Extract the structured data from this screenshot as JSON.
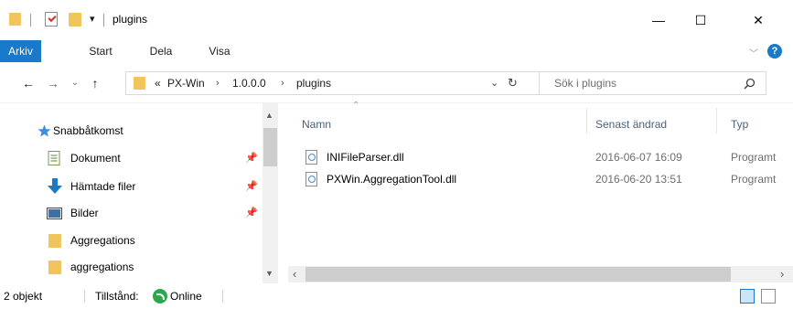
{
  "window": {
    "title": "plugins",
    "controls": {
      "minimize": "—",
      "maximize": "☐",
      "close": "✕"
    }
  },
  "ribbon": {
    "tabs": [
      {
        "label": "Arkiv",
        "active": true
      },
      {
        "label": "Start",
        "active": false
      },
      {
        "label": "Dela",
        "active": false
      },
      {
        "label": "Visa",
        "active": false
      }
    ],
    "help": "?"
  },
  "address": {
    "overflow": "«",
    "crumbs": [
      "PX-Win",
      "1.0.0.0",
      "plugins"
    ],
    "separator": "›"
  },
  "search": {
    "placeholder": "Sök i plugins"
  },
  "nav_pane": {
    "items": [
      {
        "label": "Snabbåtkomst",
        "icon": "star-icon",
        "pinned": false
      },
      {
        "label": "Dokument",
        "icon": "documents-icon",
        "pinned": true
      },
      {
        "label": "Hämtade filer",
        "icon": "download-icon",
        "pinned": true
      },
      {
        "label": "Bilder",
        "icon": "pictures-icon",
        "pinned": true
      },
      {
        "label": "Aggregations",
        "icon": "folder-icon",
        "pinned": false
      },
      {
        "label": "aggregations",
        "icon": "folder-icon",
        "pinned": false
      }
    ]
  },
  "file_list": {
    "columns": [
      "Namn",
      "Senast ändrad",
      "Typ"
    ],
    "rows": [
      {
        "name": "INIFileParser.dll",
        "modified": "2016-06-07 16:09",
        "type": "Programt"
      },
      {
        "name": "PXWin.AggregationTool.dll",
        "modified": "2016-06-20 13:51",
        "type": "Programt"
      }
    ]
  },
  "status": {
    "count": "2 objekt",
    "state_label": "Tillstånd:",
    "state_value": "Online"
  },
  "colors": {
    "accent": "#1979ca",
    "folder": "#f2c55c",
    "online": "#2aa84a"
  }
}
